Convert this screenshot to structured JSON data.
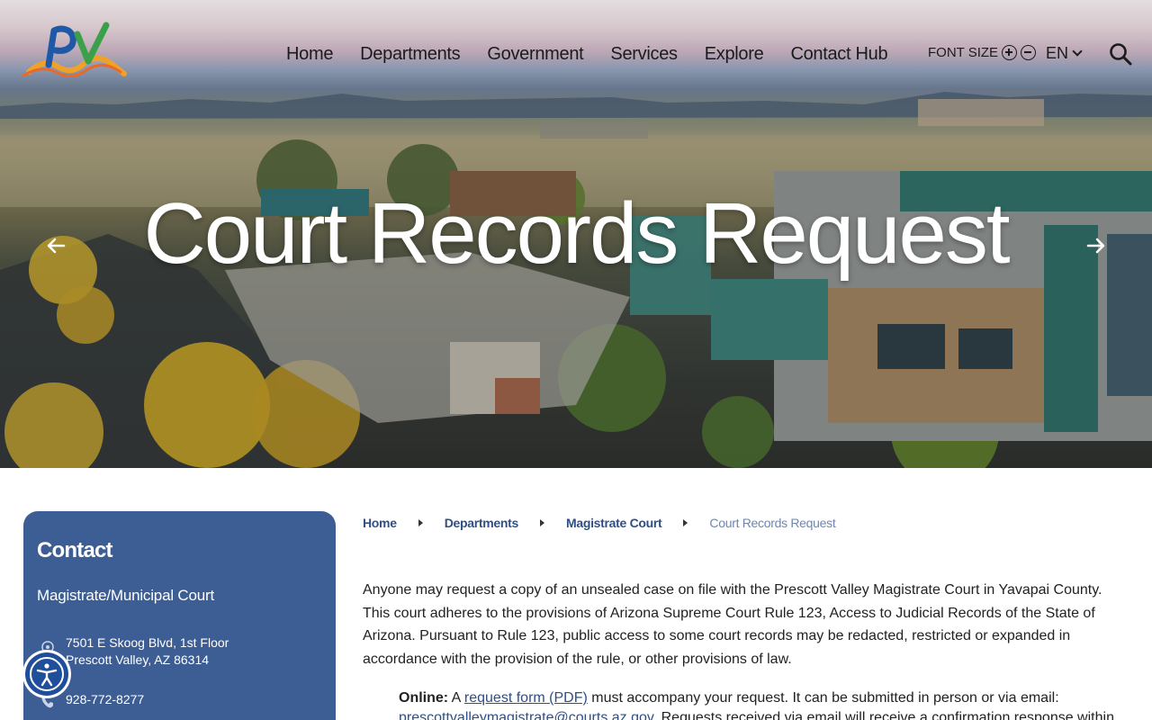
{
  "header": {
    "logo_text": "PV",
    "nav": [
      "Home",
      "Departments",
      "Government",
      "Services",
      "Explore",
      "Contact Hub"
    ],
    "font_size_label": "FONT SIZE",
    "language": "EN"
  },
  "hero": {
    "title": "Court Records Request"
  },
  "contact": {
    "heading": "Contact",
    "org": "Magistrate/Municipal Court",
    "address_line1": "7501 E Skoog Blvd, 1st Floor",
    "address_line2": "Prescott Valley, AZ 86314",
    "phone": "928-772-8277"
  },
  "breadcrumb": {
    "home": "Home",
    "departments": "Departments",
    "magistrate": "Magistrate Court",
    "current": "Court Records Request"
  },
  "main": {
    "intro": "Anyone may request a copy of an unsealed case on file with the Prescott Valley Magistrate Court in Yavapai County. This court adheres to the provisions of Arizona Supreme Court Rule 123, Access to Judicial Records of the State of Arizona. Pursuant to Rule 123, public access to some court records may be redacted, restricted or expanded in accordance with the provision of the rule, or other provisions of law.",
    "online_label": "Online:",
    "online_pre": " A ",
    "online_link": "request form (PDF)",
    "online_post": " must accompany your request. It can be submitted in person or via email:",
    "email_link": "prescottvalleymagistrate@courts.az.gov",
    "email_post": ". Requests received via email will receive a confirmation response within"
  },
  "colors": {
    "contact_bg": "#3d5e94",
    "link": "#2f4f86",
    "crumb_current": "#6d86b5",
    "a11y": "#1f4f9a"
  }
}
